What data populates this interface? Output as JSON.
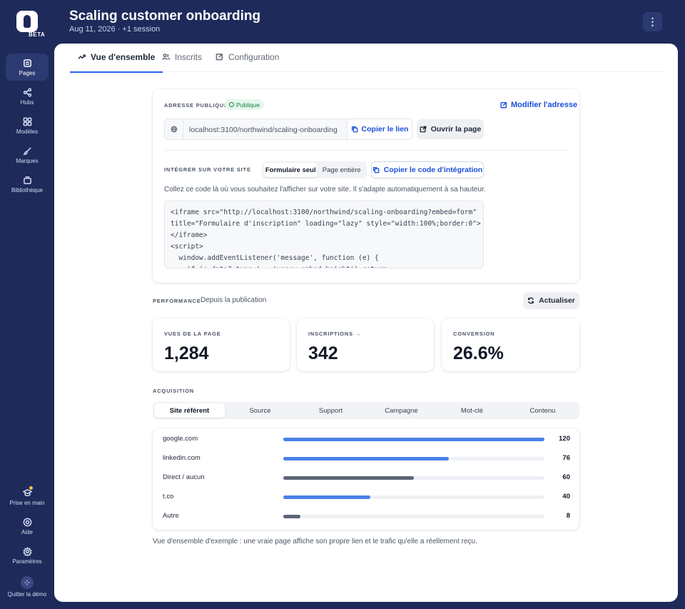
{
  "brand": {
    "beta_label": "BETA"
  },
  "rail": {
    "items": [
      {
        "label": "Pages",
        "icon": "pages-icon",
        "active": true
      },
      {
        "label": "Hubs",
        "icon": "share-icon",
        "active": false
      },
      {
        "label": "Modèles",
        "icon": "grid-icon",
        "active": false
      },
      {
        "label": "Marques",
        "icon": "brush-icon",
        "active": false
      },
      {
        "label": "Bibliothèque",
        "icon": "library-icon",
        "active": false
      }
    ],
    "bottom": [
      {
        "label": "Prise en main",
        "icon": "graduation-icon"
      },
      {
        "label": "Aide",
        "icon": "help-icon"
      },
      {
        "label": "Paramètres",
        "icon": "gear-icon"
      },
      {
        "label": "Quitter la démo",
        "icon": "exit-demo-icon"
      }
    ]
  },
  "header": {
    "title": "Scaling customer onboarding",
    "subtitle": "Aug 11, 2026 · +1 session",
    "more_icon": "⋮"
  },
  "tabs": [
    {
      "label": "Vue d'ensemble",
      "icon": "trend-icon"
    },
    {
      "label": "Inscrits",
      "icon": "users-icon"
    },
    {
      "label": "Configuration",
      "icon": "edit-icon"
    }
  ],
  "address": {
    "caption": "ADRESSE PUBLIQUE",
    "badge": "Publique",
    "edit_label": "Modifier l'adresse",
    "url": "localhost:3100/northwind/scaling-onboarding",
    "copy_label": "Copier le lien",
    "open_label": "Ouvrir la page"
  },
  "embed": {
    "caption": "INTÉGRER SUR VOTRE SITE",
    "mode_form": "Formulaire seul",
    "mode_page": "Page entière",
    "copy_label": "Copier le code d'intégration",
    "description": "Collez ce code là où vous souhaitez l'afficher sur votre site. Il s'adapte automatiquement à sa hauteur.",
    "code": "<iframe src=\"http://localhost:3100/northwind/scaling-onboarding?embed=form\"\ntitle=\"Formulaire d'inscription\" loading=\"lazy\" style=\"width:100%;border:0\">\n</iframe>\n<script>\n  window.addEventListener('message', function (e) {\n    if (e.data?.type !== 'vesey:embed:height') return"
  },
  "performance": {
    "caption": "PERFORMANCE",
    "since": "Depuis la publication",
    "refresh_label": "Actualiser",
    "stats": [
      {
        "label": "VUES DE LA PAGE",
        "value": "1,284"
      },
      {
        "label": "INSCRIPTIONS →",
        "value": "342"
      },
      {
        "label": "CONVERSION",
        "value": "26.6%"
      }
    ]
  },
  "acquisition": {
    "caption": "ACQUISITION",
    "tabs": [
      "Site référent",
      "Source",
      "Support",
      "Campagne",
      "Mot-clé",
      "Contenu"
    ],
    "rows": [
      {
        "name": "google.com",
        "value": 120,
        "color": "#4a80e8"
      },
      {
        "name": "linkedin.com",
        "value": 76,
        "color": "#4a80e8"
      },
      {
        "name": "Direct / aucun",
        "value": 60,
        "color": "#5b6577"
      },
      {
        "name": "t.co",
        "value": 40,
        "color": "#4a80e8"
      },
      {
        "name": "Autre",
        "value": 8,
        "color": "#5b6577"
      }
    ],
    "max_value": 120
  },
  "footnote": "Vue d'ensemble d'exemple : une vraie page affiche son propre lien et le trafic qu'elle a réellement reçu.",
  "colors": {
    "navy": "#1e2a5a",
    "accent": "#2563eb",
    "success": "#15803d",
    "bar_blue": "#4a80e8",
    "bar_grey": "#5b6577"
  }
}
